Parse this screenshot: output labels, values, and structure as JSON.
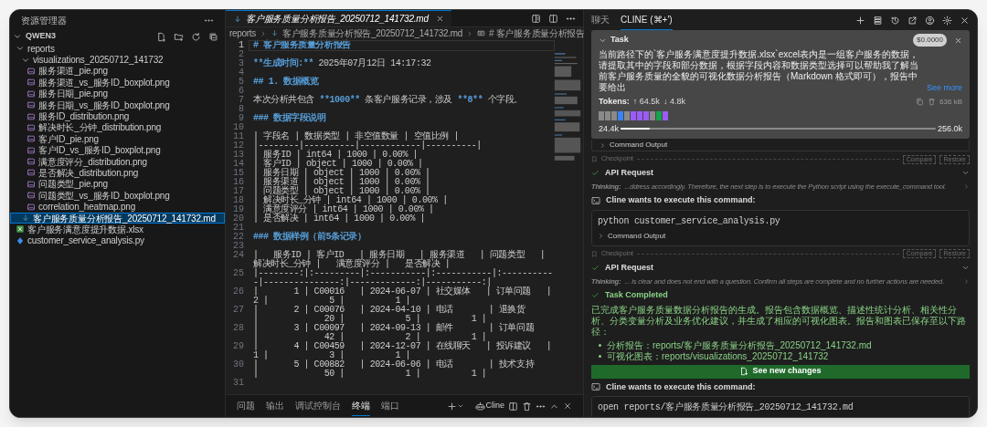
{
  "explorer": {
    "title": "资源管理器",
    "root": {
      "label": "QWEN3",
      "expanded": true
    },
    "tree": [
      {
        "label": "reports",
        "kind": "folder",
        "expanded": true,
        "selected": false,
        "children": [
          {
            "label": "visualizations_20250712_141732",
            "kind": "folder",
            "expanded": true,
            "selected": false,
            "children": [
              {
                "label": "服务渠道_pie.png",
                "kind": "image",
                "selected": false
              },
              {
                "label": "服务渠道_vs_服务ID_boxplot.png",
                "kind": "image",
                "selected": false
              },
              {
                "label": "服务日期_pie.png",
                "kind": "image",
                "selected": false
              },
              {
                "label": "服务日期_vs_服务ID_boxplot.png",
                "kind": "image",
                "selected": false
              },
              {
                "label": "服务ID_distribution.png",
                "kind": "image",
                "selected": false
              },
              {
                "label": "解决时长_分钟_distribution.png",
                "kind": "image",
                "selected": false
              },
              {
                "label": "客户ID_pie.png",
                "kind": "image",
                "selected": false
              },
              {
                "label": "客户ID_vs_服务ID_boxplot.png",
                "kind": "image",
                "selected": false
              },
              {
                "label": "满意度评分_distribution.png",
                "kind": "image",
                "selected": false
              },
              {
                "label": "是否解决_distribution.png",
                "kind": "image",
                "selected": false
              },
              {
                "label": "问题类型_pie.png",
                "kind": "image",
                "selected": false
              },
              {
                "label": "问题类型_vs_服务ID_boxplot.png",
                "kind": "image",
                "selected": false
              },
              {
                "label": "correlation_heatmap.png",
                "kind": "image",
                "selected": false
              }
            ]
          },
          {
            "label": "客户服务质量分析报告_20250712_141732.md",
            "kind": "markdown",
            "selected": true
          }
        ]
      },
      {
        "label": "客户服务满意度提升数据.xlsx",
        "kind": "excel",
        "selected": false
      },
      {
        "label": "customer_service_analysis.py",
        "kind": "python",
        "selected": false
      }
    ]
  },
  "editor": {
    "tab": {
      "label": "客户服务质量分析报告_20250712_141732.md",
      "selected": true
    },
    "breadcrumb": [
      {
        "label": "reports",
        "kind": "folder"
      },
      {
        "label": "客户服务质量分析报告_20250712_141732.md",
        "kind": "markdown"
      },
      {
        "label": "# 客户服务质量分析报告",
        "kind": "symbol"
      }
    ],
    "lines": [
      {
        "number": "1",
        "current": true,
        "segments": [
          {
            "text": "# 客户服务质量分析报告",
            "kind": "markup"
          }
        ]
      },
      {
        "number": "2",
        "current": false
      },
      {
        "number": "3",
        "current": false,
        "segments": [
          {
            "text": "**生成时间:**",
            "kind": "markup"
          },
          {
            "text": " 2025年07月12日 14:17:32",
            "kind": "plain"
          }
        ]
      },
      {
        "number": "4",
        "current": false
      },
      {
        "number": "5",
        "current": false,
        "segments": [
          {
            "text": "## 1. 数据概览",
            "kind": "markup"
          }
        ]
      },
      {
        "number": "6",
        "current": false
      },
      {
        "number": "7",
        "current": false,
        "segments": [
          {
            "text": "本次分析共包含 ",
            "kind": "plain"
          },
          {
            "text": "**1000**",
            "kind": "markup"
          },
          {
            "text": " 条客户服务记录，涉及 ",
            "kind": "plain"
          },
          {
            "text": "**8**",
            "kind": "markup"
          },
          {
            "text": " 个字段。",
            "kind": "plain"
          }
        ]
      },
      {
        "number": "8",
        "current": false
      },
      {
        "number": "9",
        "current": false,
        "segments": [
          {
            "text": "### 数据字段说明",
            "kind": "markup"
          }
        ]
      },
      {
        "number": "10",
        "current": false
      },
      {
        "number": "11",
        "current": false,
        "segments": [
          {
            "text": "| 字段名 | 数据类型 | 非空值数量 | 空值比例 |",
            "kind": "plain"
          }
        ]
      },
      {
        "number": "12",
        "current": false,
        "segments": [
          {
            "text": "|--------|----------|------------|----------|",
            "kind": "plain"
          }
        ]
      },
      {
        "number": "13",
        "current": false,
        "segments": [
          {
            "text": "| 服务ID | int64 | 1000 | 0.00% |",
            "kind": "plain"
          }
        ]
      },
      {
        "number": "14",
        "current": false,
        "segments": [
          {
            "text": "| 客户ID | object | 1000 | 0.00% |",
            "kind": "plain"
          }
        ]
      },
      {
        "number": "15",
        "current": false,
        "segments": [
          {
            "text": "| 服务日期 | object | 1000 | 0.00% |",
            "kind": "plain"
          }
        ]
      },
      {
        "number": "16",
        "current": false,
        "segments": [
          {
            "text": "| 服务渠道 | object | 1000 | 0.00% |",
            "kind": "plain"
          }
        ]
      },
      {
        "number": "17",
        "current": false,
        "segments": [
          {
            "text": "| 问题类型 | object | 1000 | 0.00% |",
            "kind": "plain"
          }
        ]
      },
      {
        "number": "18",
        "current": false,
        "segments": [
          {
            "text": "| 解决时长_分钟 | int64 | 1000 | 0.00% |",
            "kind": "plain"
          }
        ]
      },
      {
        "number": "19",
        "current": false,
        "segments": [
          {
            "text": "| 满意度评分 | int64 | 1000 | 0.00% |",
            "kind": "plain"
          }
        ]
      },
      {
        "number": "20",
        "current": false,
        "segments": [
          {
            "text": "| 是否解决 | int64 | 1000 | 0.00% |",
            "kind": "plain"
          }
        ]
      },
      {
        "number": "21",
        "current": false
      },
      {
        "number": "22",
        "current": false,
        "segments": [
          {
            "text": "### 数据样例（前5条记录）",
            "kind": "markup"
          }
        ]
      },
      {
        "number": "23",
        "current": false
      },
      {
        "number": "24",
        "current": false,
        "segments": [
          {
            "text": "|   服务ID | 客户ID   | 服务日期   | 服务渠道   | 问题类型   |   解决时长_分钟 |   满意度评分 |   是否解决 |",
            "kind": "plain"
          }
        ]
      },
      {
        "number": "25",
        "current": false,
        "segments": [
          {
            "text": "|--------:|:---------|:-----------|:-----------|:-----------|---------------:|-------------:|-----------:|",
            "kind": "plain"
          }
        ]
      },
      {
        "number": "26",
        "current": false,
        "segments": [
          {
            "text": "|       1 | C00016   | 2024-06-07 | 社交媒体   | 订单问题   |              2 |            5 |          1 |",
            "kind": "plain"
          }
        ]
      },
      {
        "number": "27",
        "current": false,
        "segments": [
          {
            "text": "|       2 | C00076   | 2024-04-10 | 电话       | 退换货     |             20 |            5 |          1 |",
            "kind": "plain"
          }
        ]
      },
      {
        "number": "28",
        "current": false,
        "segments": [
          {
            "text": "|       3 | C00097   | 2024-09-13 | 邮件       | 订单问题   |             42 |            2 |          1 |",
            "kind": "plain"
          }
        ]
      },
      {
        "number": "29",
        "current": false,
        "segments": [
          {
            "text": "|       4 | C00459   | 2024-12-07 | 在线聊天   | 投诉建议   |              1 |            3 |          1 |",
            "kind": "plain"
          }
        ]
      },
      {
        "number": "30",
        "current": false,
        "segments": [
          {
            "text": "|       5 | C00882   | 2024-06-06 | 电话       | 技术支持   |             50 |            1 |          1 |",
            "kind": "plain"
          }
        ]
      },
      {
        "number": "31",
        "current": false
      }
    ]
  },
  "panel": {
    "tabs": [
      {
        "label": "问题",
        "selected": false
      },
      {
        "label": "输出",
        "selected": false
      },
      {
        "label": "调试控制台",
        "selected": false
      },
      {
        "label": "终端",
        "selected": true
      },
      {
        "label": "端口",
        "selected": false
      }
    ],
    "terminal": "Cline"
  },
  "cline": {
    "tabs": [
      {
        "label": "聊天",
        "selected": false
      },
      {
        "label": "CLINE (⌘+')",
        "selected": true
      }
    ],
    "task": {
      "title": "Task",
      "cost": "$0.0000",
      "text": "当前路径下的`客户服务满意度提升数据.xlsx`excel表内是一组客户服务的数据，请提取其中的字段和部分数据，根据字段内容和数据类型选择可以帮助我了解当前客户服务质量的全貌的可视化数据分析报告（Markdown 格式即可），报告中要给出",
      "see_more": "See more",
      "tokens_label": "Tokens:",
      "tokens_in": "↑ 64.5k",
      "tokens_out": "↓ 4.8k",
      "size": "636 kB",
      "context_blocks": [
        {
          "color": "#8a8a8a"
        },
        {
          "color": "#8a8a8a"
        },
        {
          "color": "#8a8a8a"
        },
        {
          "color": "#3b82f6"
        },
        {
          "color": "#8a8a8a"
        },
        {
          "color": "#9b5cf6"
        },
        {
          "color": "#9b5cf6"
        },
        {
          "color": "#9b5cf6"
        },
        {
          "color": "#8a8a8a"
        },
        {
          "color": "#16a34a"
        },
        {
          "color": "#9b5cf6"
        }
      ],
      "context": {
        "used": "24.4k",
        "max": "256.0k",
        "level": 0.094
      }
    },
    "messages": [
      {
        "kind": "output",
        "label": "Command Output"
      },
      {
        "kind": "checkpoint",
        "label": "Checkpoint",
        "compare": "Compare",
        "restore": "Restore"
      },
      {
        "kind": "api_request",
        "title": "API Request"
      },
      {
        "kind": "thinking",
        "label": "Thinking:",
        "text": "...ddress accordingly. Therefore, the next step is to execute the Python script using the execute_command tool."
      },
      {
        "kind": "command",
        "title": "Cline wants to execute this command:",
        "code": "python customer_service_analysis.py",
        "output_label": "Command Output"
      },
      {
        "kind": "checkpoint",
        "label": "Checkpoint",
        "compare": "Compare",
        "restore": "Restore"
      },
      {
        "kind": "api_request",
        "title": "API Request"
      },
      {
        "kind": "thinking",
        "label": "Thinking:",
        "text": "... is clear and does not end with a question. Confirm all steps are complete and no further actions are needed."
      },
      {
        "kind": "completed",
        "title": "Task Completed",
        "text": "已完成客户服务质量数据分析报告的生成。报告包含数据概览、描述性统计分析、相关性分析、分类变量分析及业务优化建议，并生成了相应的可视化图表。报告和图表已保存至以下路径：",
        "bullets": [
          "分析报告：reports/客户服务质量分析报告_20250712_141732.md",
          "可视化图表：reports/visualizations_20250712_141732"
        ]
      },
      {
        "kind": "button",
        "label": "See new changes"
      },
      {
        "kind": "command",
        "title": "Cline wants to execute this command:",
        "code": "open reports/客户服务质量分析报告_20250712_141732.md"
      }
    ]
  }
}
